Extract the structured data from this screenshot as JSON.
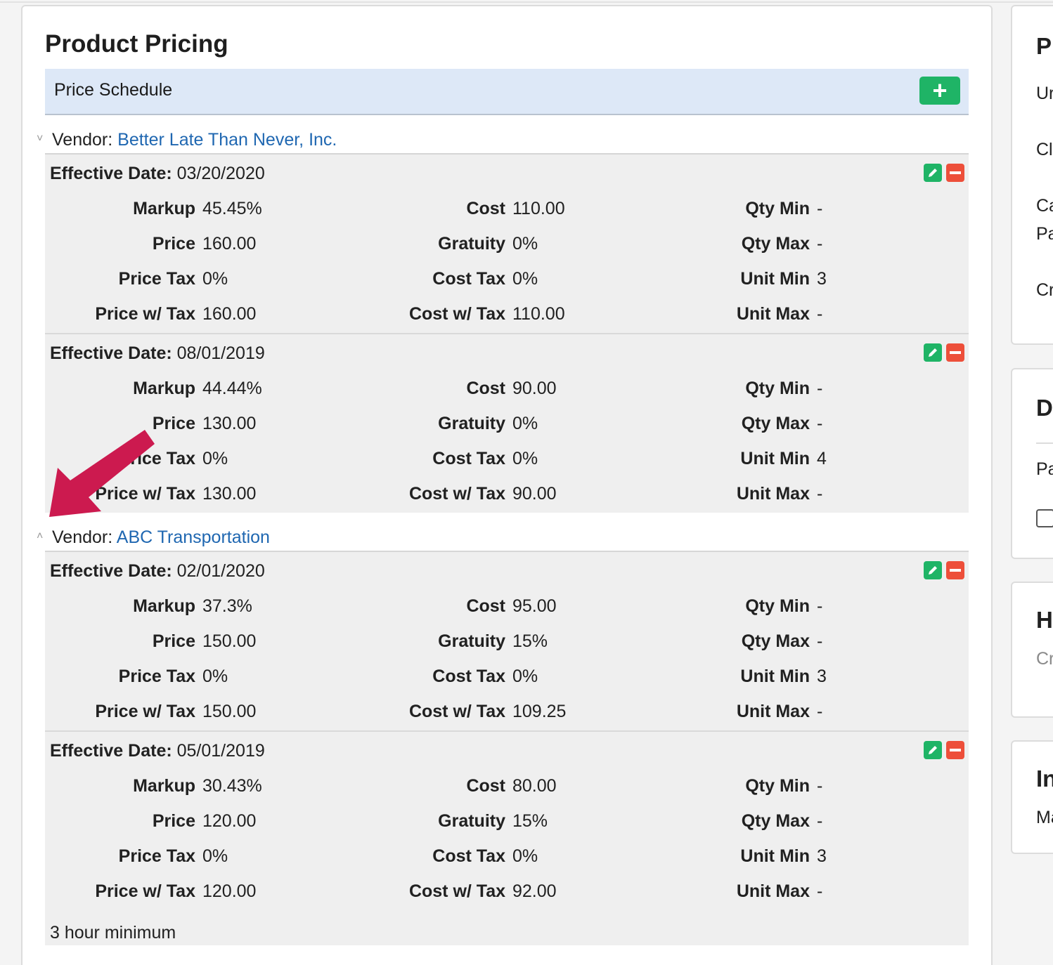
{
  "card": {
    "title": "Product Pricing",
    "schedule_label": "Price Schedule",
    "add_label": "+"
  },
  "vendors": [
    {
      "toggle": "˅",
      "label": "Vendor:",
      "name": "Better Late Than Never, Inc.",
      "entries": [
        {
          "eff_label": "Effective Date:",
          "eff_value": "03/20/2020",
          "markup": "45.45%",
          "price": "160.00",
          "price_tax": "0%",
          "price_w_tax": "160.00",
          "cost": "110.00",
          "gratuity": "0%",
          "cost_tax": "0%",
          "cost_w_tax": "110.00",
          "qty_min": "-",
          "qty_max": "-",
          "unit_min": "3",
          "unit_max": "-"
        },
        {
          "eff_label": "Effective Date:",
          "eff_value": "08/01/2019",
          "markup": "44.44%",
          "price": "130.00",
          "price_tax": "0%",
          "price_w_tax": "130.00",
          "cost": "90.00",
          "gratuity": "0%",
          "cost_tax": "0%",
          "cost_w_tax": "90.00",
          "qty_min": "-",
          "qty_max": "-",
          "unit_min": "4",
          "unit_max": "-"
        }
      ]
    },
    {
      "toggle": "˄",
      "label": "Vendor:",
      "name": "ABC Transportation",
      "entries": [
        {
          "eff_label": "Effective Date:",
          "eff_value": "02/01/2020",
          "markup": "37.3%",
          "price": "150.00",
          "price_tax": "0%",
          "price_w_tax": "150.00",
          "cost": "95.00",
          "gratuity": "15%",
          "cost_tax": "0%",
          "cost_w_tax": "109.25",
          "qty_min": "-",
          "qty_max": "-",
          "unit_min": "3",
          "unit_max": "-"
        },
        {
          "eff_label": "Effective Date:",
          "eff_value": "05/01/2019",
          "markup": "30.43%",
          "price": "120.00",
          "price_tax": "0%",
          "price_w_tax": "120.00",
          "cost": "80.00",
          "gratuity": "15%",
          "cost_tax": "0%",
          "cost_w_tax": "92.00",
          "qty_min": "-",
          "qty_max": "-",
          "unit_min": "3",
          "unit_max": "-",
          "note": "3 hour minimum"
        }
      ]
    }
  ],
  "labels": {
    "markup": "Markup",
    "price": "Price",
    "price_tax": "Price Tax",
    "price_w_tax": "Price w/ Tax",
    "cost": "Cost",
    "gratuity": "Gratuity",
    "cost_tax": "Cost Tax",
    "cost_w_tax": "Cost w/ Tax",
    "qty_min": "Qty Min",
    "qty_max": "Qty Max",
    "unit_min": "Unit Min",
    "unit_max": "Unit Max"
  },
  "side_cards": [
    {
      "title": "Pr",
      "lines": [
        "Ur",
        "Cl",
        "Ca",
        "Pa",
        "Cr"
      ]
    },
    {
      "title": "De",
      "lines": [
        "Pa"
      ]
    },
    {
      "title": "H",
      "lines": [
        "Cr"
      ]
    },
    {
      "title": "In",
      "lines": [
        "Ma"
      ]
    }
  ],
  "colors": {
    "accent_green": "#1fb466",
    "delete_red": "#ed4f3a",
    "link_blue": "#1f67b1",
    "annotation_arrow": "#cc1a4f"
  }
}
